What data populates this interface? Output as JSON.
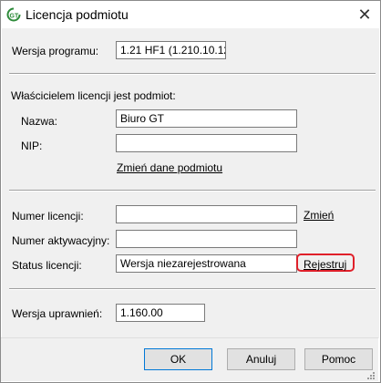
{
  "window": {
    "title": "Licencja podmiotu",
    "close_glyph": "✕"
  },
  "program": {
    "version_label": "Wersja programu:",
    "version_value": "1.21 HF1 (1.210.10.12"
  },
  "owner": {
    "header": "Właścicielem licencji jest podmiot:",
    "name_label": "Nazwa:",
    "name_value": "Biuro GT",
    "nip_label": "NIP:",
    "nip_value": "",
    "change_link": "Zmień dane podmiotu"
  },
  "license": {
    "number_label": "Numer licencji:",
    "number_value": "",
    "change_link": "Zmień",
    "activation_label": "Numer aktywacyjny:",
    "activation_value": "",
    "status_label": "Status licencji:",
    "status_value": "Wersja niezarejestrowana",
    "register_link": "Rejestruj"
  },
  "permissions": {
    "version_label": "Wersja uprawnień:",
    "version_value": "1.160.00"
  },
  "buttons": {
    "ok": "OK",
    "cancel": "Anuluj",
    "help": "Pomoc"
  },
  "colors": {
    "highlight": "#e0202a",
    "icon_green": "#2e8b3a"
  }
}
